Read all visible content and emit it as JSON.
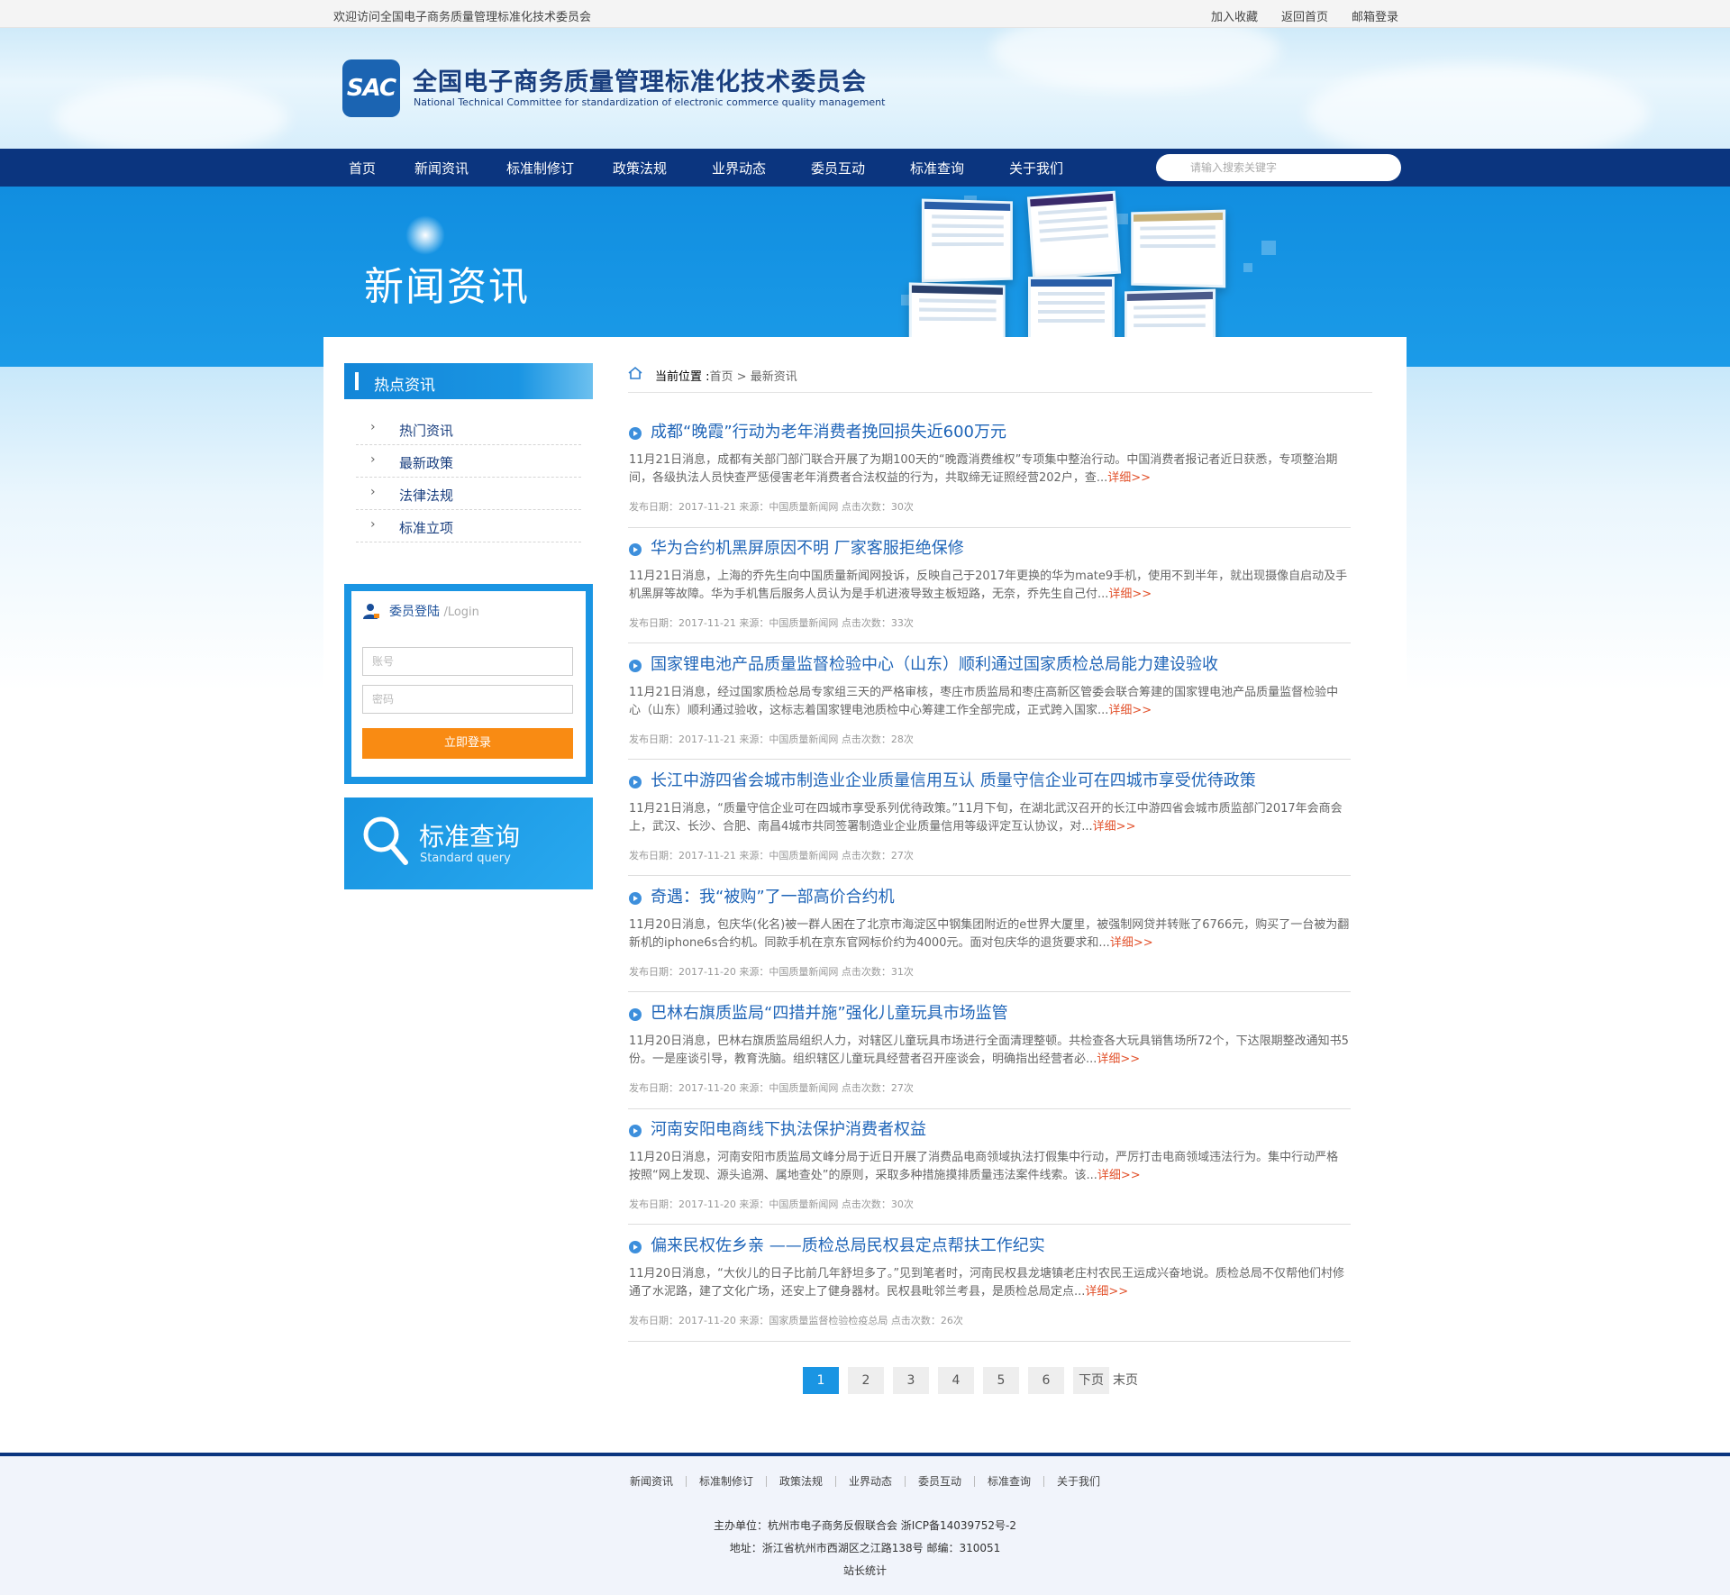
{
  "topbar": {
    "welcome": "欢迎访问全国电子商务质量管理标准化技术委员会",
    "links": [
      "加入收藏",
      "返回首页",
      "邮箱登录"
    ]
  },
  "header": {
    "logo_mark": "SAC",
    "title_cn": "全国电子商务质量管理标准化技术委员会",
    "title_en": "National Technical Committee for standardization of electronic commerce quality management"
  },
  "nav": {
    "items": [
      "首页",
      "新闻资讯",
      "标准制修订",
      "政策法规",
      "业界动态",
      "委员互动",
      "标准查询",
      "关于我们"
    ],
    "search_placeholder": "请输入搜索关键字"
  },
  "banner": {
    "title": "新闻资讯"
  },
  "sidebar": {
    "title": "热点资讯",
    "items": [
      "热门资讯",
      "最新政策",
      "法律法规",
      "标准立项"
    ],
    "login": {
      "title": "委员登陆",
      "subtitle": "/Login",
      "account_placeholder": "账号",
      "password_placeholder": "密码",
      "button": "立即登录"
    },
    "query": {
      "title": "标准查询",
      "subtitle": "Standard query"
    }
  },
  "breadcrumb": {
    "label": "当前位置 :",
    "home": "首页",
    "sep": " > ",
    "current": "最新资讯"
  },
  "articles": [
    {
      "title": "成都“晚霞”行动为老年消费者挽回损失近600万元",
      "summary": "11月21日消息，成都有关部门部门联合开展了为期100天的“晚霞消费维权”专项集中整治行动。中国消费者报记者近日获悉，专项整治期间，各级执法人员快查严惩侵害老年消费者合法权益的行为，共取缔无证照经营202户，查...",
      "more": "详细>>",
      "meta": "发布日期：2017-11-21 来源：中国质量新闻网 点击次数：30次"
    },
    {
      "title": "华为合约机黑屏原因不明 厂家客服拒绝保修",
      "summary": "11月21日消息，上海的乔先生向中国质量新闻网投诉，反映自己于2017年更换的华为mate9手机，使用不到半年，就出现摄像自启动及手机黑屏等故障。华为手机售后服务人员认为是手机进液导致主板短路，无奈，乔先生自己付...",
      "more": "详细>>",
      "meta": "发布日期：2017-11-21 来源：中国质量新闻网 点击次数：33次"
    },
    {
      "title": "国家锂电池产品质量监督检验中心（山东）顺利通过国家质检总局能力建设验收",
      "summary": "11月21日消息，经过国家质检总局专家组三天的严格审核，枣庄市质监局和枣庄高新区管委会联合筹建的国家锂电池产品质量监督检验中心（山东）顺利通过验收，这标志着国家锂电池质检中心筹建工作全部完成，正式跨入国家...",
      "more": "详细>>",
      "meta": "发布日期：2017-11-21 来源：中国质量新闻网 点击次数：28次"
    },
    {
      "title": "长江中游四省会城市制造业企业质量信用互认 质量守信企业可在四城市享受优待政策",
      "summary": "11月21日消息，“质量守信企业可在四城市享受系列优待政策。”11月下旬，在湖北武汉召开的长江中游四省会城市质监部门2017年会商会上，武汉、长沙、合肥、南昌4城市共同签署制造业企业质量信用等级评定互认协议，对...",
      "more": "详细>>",
      "meta": "发布日期：2017-11-21 来源：中国质量新闻网 点击次数：27次"
    },
    {
      "title": "奇遇：我“被购”了一部高价合约机",
      "summary": "11月20日消息，包庆华(化名)被一群人困在了北京市海淀区中钢集团附近的e世界大厦里，被强制网贷并转账了6766元，购买了一台被为翻新机的iphone6s合约机。同款手机在京东官网标价约为4000元。面对包庆华的退货要求和...",
      "more": "详细>>",
      "meta": "发布日期：2017-11-20 来源：中国质量新闻网 点击次数：31次"
    },
    {
      "title": "巴林右旗质监局“四措并施”强化儿童玩具市场监管",
      "summary": "11月20日消息，巴林右旗质监局组织人力，对辖区儿童玩具市场进行全面清理整顿。共检查各大玩具销售场所72个，下达限期整改通知书5份。一是座谈引导，教育洗脑。组织辖区儿童玩具经营者召开座谈会，明确指出经营者必...",
      "more": "详细>>",
      "meta": "发布日期：2017-11-20 来源：中国质量新闻网 点击次数：27次"
    },
    {
      "title": "河南安阳电商线下执法保护消费者权益",
      "summary": "11月20日消息，河南安阳市质监局文峰分局于近日开展了消费品电商领域执法打假集中行动，严厉打击电商领域违法行为。集中行动严格按照“网上发现、源头追溯、属地查处”的原则，采取多种措施摸排质量违法案件线索。该...",
      "more": "详细>>",
      "meta": "发布日期：2017-11-20 来源：中国质量新闻网 点击次数：30次"
    },
    {
      "title": "偏来民权佐乡亲 ——质检总局民权县定点帮扶工作纪实",
      "summary": "11月20日消息，“大伙儿的日子比前几年舒坦多了。”见到笔者时，河南民权县龙塘镇老庄村农民王运成兴奋地说。质检总局不仅帮他们村修通了水泥路，建了文化广场，还安上了健身器材。民权县毗邻兰考县，是质检总局定点...",
      "more": "详细>>",
      "meta": "发布日期：2017-11-20 来源：国家质量监督检验检疫总局 点击次数：26次"
    }
  ],
  "pagination": {
    "pages": [
      "1",
      "2",
      "3",
      "4",
      "5",
      "6"
    ],
    "active": "1",
    "next": "下页",
    "last": "末页"
  },
  "footer": {
    "links": [
      "新闻资讯",
      "标准制修订",
      "政策法规",
      "业界动态",
      "委员互动",
      "标准查询",
      "关于我们"
    ],
    "line1": "主办单位：杭州市电子商务反假联合会 浙ICP备14039752号-2",
    "line2": "地址：浙江省杭州市西湖区之江路138号 邮编：310051",
    "line3": "站长统计"
  },
  "colors": {
    "nav_bg": "#0b357f",
    "banner_bg": "#1a95e3",
    "accent_orange": "#f98b13",
    "link_blue": "#1f65b8",
    "more_red": "#e2512b"
  }
}
